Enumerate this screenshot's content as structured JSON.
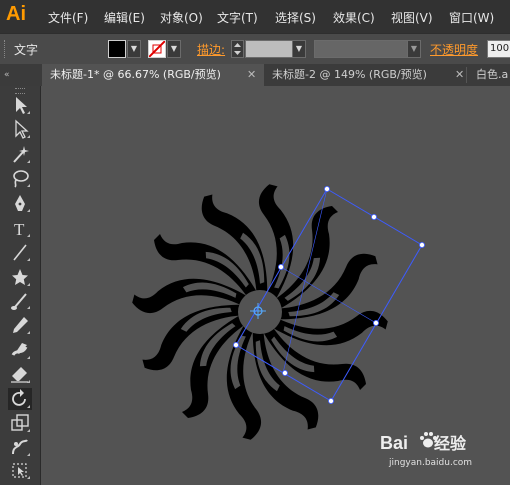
{
  "app": {
    "logo": "Ai"
  },
  "menu": [
    {
      "label": "文件(F)"
    },
    {
      "label": "编辑(E)"
    },
    {
      "label": "对象(O)"
    },
    {
      "label": "文字(T)"
    },
    {
      "label": "选择(S)"
    },
    {
      "label": "效果(C)"
    },
    {
      "label": "视图(V)"
    },
    {
      "label": "窗口(W)"
    }
  ],
  "control": {
    "type_label": "文字",
    "stroke_label": "描边:",
    "opacity_label": "不透明度",
    "opacity_value": "100"
  },
  "tabs": [
    {
      "label": "未标题-1* @ 66.67% (RGB/预览)",
      "active": true
    },
    {
      "label": "未标题-2 @ 149% (RGB/预览)",
      "active": false
    },
    {
      "label": "白色.a",
      "active": false
    }
  ],
  "tools": [
    "selection-tool-icon",
    "direct-selection-tool-icon",
    "magic-wand-tool-icon",
    "lasso-tool-icon",
    "pen-tool-icon",
    "type-tool-icon",
    "line-tool-icon",
    "star-tool-icon",
    "paintbrush-tool-icon",
    "pencil-tool-icon",
    "blob-brush-tool-icon",
    "eraser-tool-icon",
    "rotate-tool-icon",
    "scale-tool-icon",
    "warp-tool-icon",
    "free-transform-tool-icon"
  ],
  "colors": {
    "accent": "#ff9a00",
    "selection": "#3d5cff",
    "artwork": "#000000",
    "canvas": "#535353"
  },
  "watermark": {
    "brand": "Bai",
    "brand2": "经验",
    "domain": "jingyan.baidu.com"
  }
}
